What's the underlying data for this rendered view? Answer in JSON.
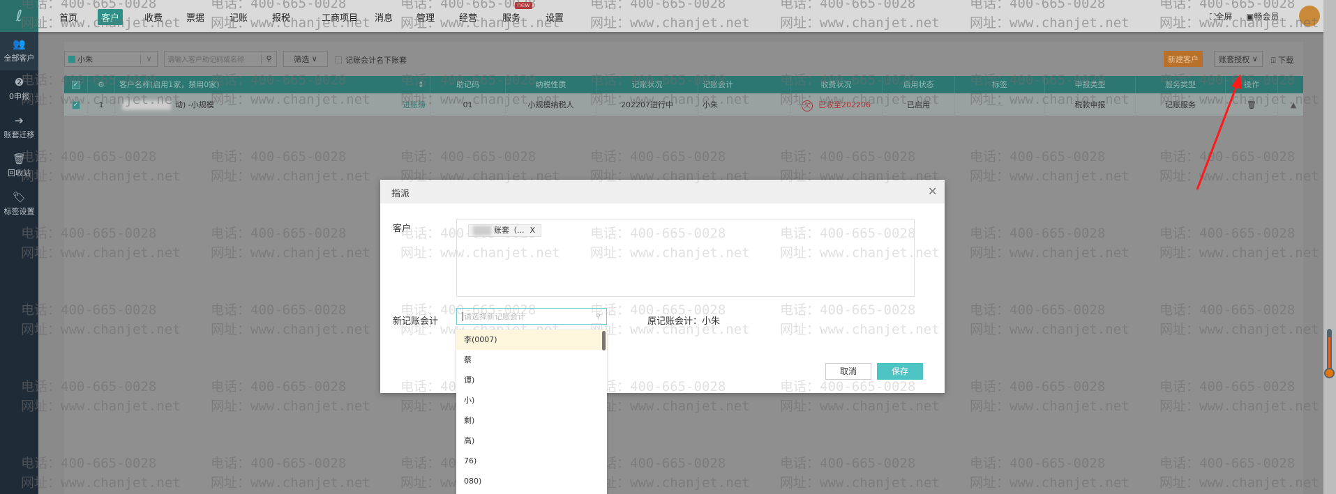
{
  "nav": {
    "items": [
      "首页",
      "客户",
      "收费",
      "票据",
      "记账",
      "报税",
      "工商项目",
      "消息",
      "管理",
      "经营",
      "服务",
      "设置"
    ],
    "active": "客户",
    "new_badge": "new",
    "fullscreen": "全屏",
    "member": "畅会员"
  },
  "sidebar": {
    "items": [
      {
        "label": "全部客户",
        "icon": "users-icon"
      },
      {
        "label": "0申报",
        "icon": "zero-report-icon"
      },
      {
        "label": "账套迁移",
        "icon": "migrate-icon"
      },
      {
        "label": "回收站",
        "icon": "trash-icon"
      },
      {
        "label": "标签设置",
        "icon": "tag-icon"
      }
    ]
  },
  "toolbar": {
    "accountant_select": "小朱",
    "search_placeholder": "请输入客户助记码或名称",
    "filter": "筛选",
    "checkbox_label": "记账会计名下账套",
    "new_customer": "新建客户",
    "auth": "账套授权",
    "download": "下载"
  },
  "table": {
    "headers": [
      "客户名称(启用1家，禁用0家)",
      "助记码",
      "纳税性质",
      "记账状况",
      "记账会计",
      "收费状况",
      "启用状态",
      "标签",
      "申报类型",
      "服务类型",
      "操作"
    ],
    "row": {
      "index": "1",
      "name": "动) -小规模",
      "enter_link": "进账簿",
      "code": "01",
      "tax_type": "小规模纳税人",
      "status": "202207进行中",
      "accountant": "小朱",
      "fee_badge": "欠",
      "fee_status": "已收至202206",
      "enabled": "已启用",
      "tag": "—",
      "report_type": "税款申报",
      "service_type": "记账服务"
    }
  },
  "watermark": {
    "phone": "电话：400-665-0028",
    "site": "网址：www.chanjet.net"
  },
  "modal": {
    "title": "指派",
    "customer_label": "客户",
    "customer_tag": "账套（...",
    "tag_close": "X",
    "new_accountant_label": "新记账会计",
    "new_accountant_placeholder": "请选择新记账会计",
    "original_accountant": "原记账会计：小朱",
    "cancel": "取消",
    "save": "保存",
    "options": [
      "李(0007)",
      "蔡",
      "谭)",
      "小)",
      "剩)",
      "高)",
      "76)",
      "080)"
    ]
  },
  "colors": {
    "accent": "#2d7773",
    "save": "#4ec3c3",
    "new_customer": "#b8702a",
    "arrow": "#ff1a1a"
  }
}
